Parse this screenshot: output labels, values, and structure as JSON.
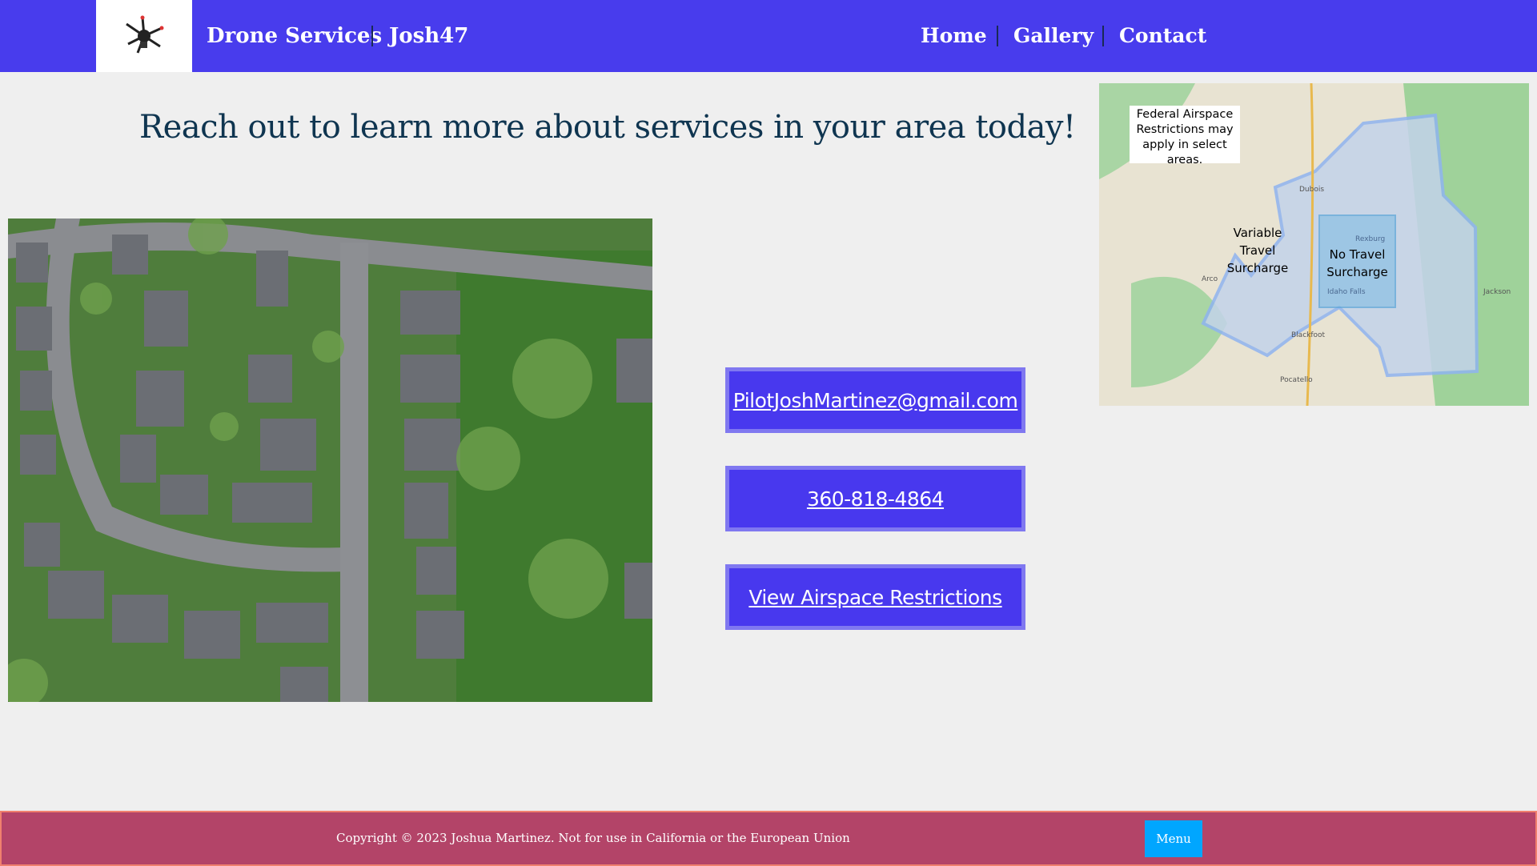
{
  "header": {
    "logo_icon": "drone-icon",
    "brand": "Drone Services",
    "username": "Josh47",
    "nav": [
      {
        "label": "Home"
      },
      {
        "label": "Gallery"
      },
      {
        "label": "Contact"
      }
    ],
    "colors": {
      "background": "#483ced",
      "text": "#ffffff"
    }
  },
  "main": {
    "headline": "Reach out to learn more about services in your area today!",
    "photo": "aerial-neighborhood-photo",
    "contact": {
      "email": "PilotJoshMartinez@gmail.com",
      "phone": "360-818-4864",
      "airspace": "View Airspace Restrictions"
    },
    "map": {
      "notice": "Federal Airspace Restrictions may apply in select areas.",
      "zone_variable": "Variable Travel Surcharge",
      "zone_none": "No Travel Surcharge",
      "places": [
        "Dubois",
        "Idaho Falls",
        "Rexburg",
        "Arco",
        "Pocatello",
        "Blackfoot",
        "Jackson"
      ]
    }
  },
  "footer": {
    "copyright": "Copyright © 2023 Joshua Martinez. Not for use in California or the European Union",
    "menu_label": "Menu",
    "colors": {
      "background": "#b34468",
      "menu": "#00a6ff"
    }
  }
}
